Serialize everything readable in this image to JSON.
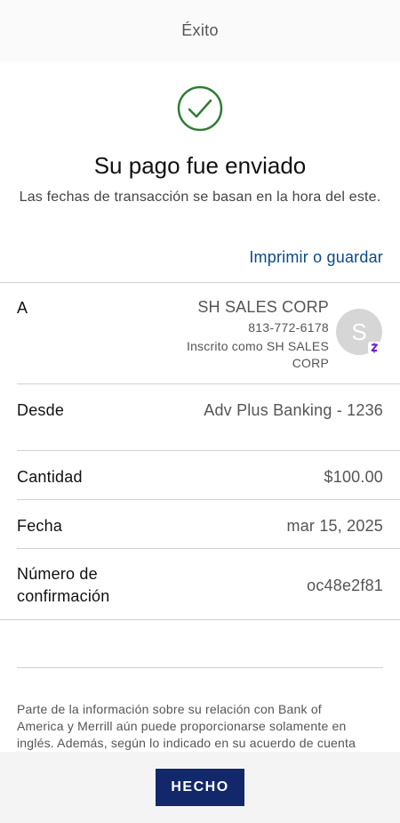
{
  "header": {
    "title": "Éxito"
  },
  "status": {
    "icon": "check-circle-icon",
    "title": "Su pago fue enviado",
    "subtitle": "Las fechas de transacción se basan en la hora del este.",
    "print_link": "Imprimir o guardar"
  },
  "details": {
    "to": {
      "label": "A",
      "name": "SH SALES CORP",
      "phone": "813-772-6178",
      "enrolled_as": "Inscrito como SH SALES CORP",
      "avatar_initial": "S",
      "badge_icon": "zelle-icon"
    },
    "from": {
      "label": "Desde",
      "value": "Adv Plus Banking - 1236"
    },
    "amount": {
      "label": "Cantidad",
      "value": "$100.00"
    },
    "date": {
      "label": "Fecha",
      "value": "mar 15, 2025"
    },
    "confirmation": {
      "label": "Número de confirmación",
      "value": "oc48e2f81"
    }
  },
  "disclaimer": "Parte de la información sobre su relación con Bank of America y Merrill aún puede proporcionarse solamente en inglés. Además, según lo indicado en su acuerdo de cuenta",
  "footer": {
    "done_label": "HECHO"
  },
  "colors": {
    "check": "#2e7d32",
    "link": "#0c4a86",
    "button": "#12286a",
    "zelle": "#6d1ed4"
  }
}
